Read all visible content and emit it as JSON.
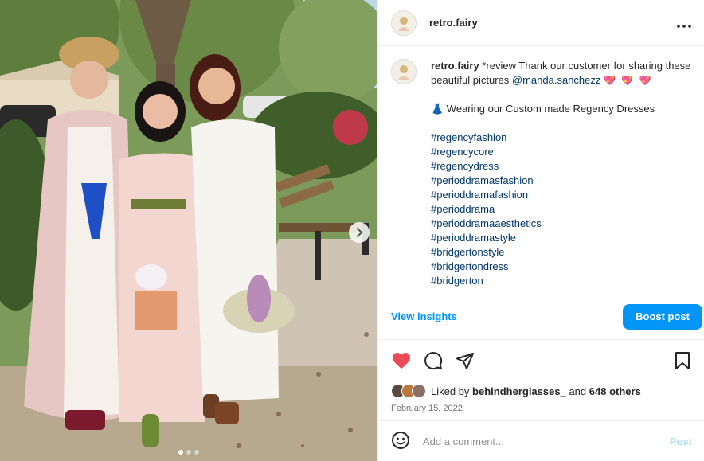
{
  "account": {
    "username": "retro.fairy"
  },
  "caption": {
    "username": "retro.fairy",
    "text": "*review Thank our customer for sharing these beautiful pictures",
    "mention": "@manda.sanchezz",
    "hearts": "💖 💖 💖",
    "dress_line": "👗 Wearing our Custom made Regency Dresses",
    "hashtags": [
      "#regencyfashion",
      "#regencycore",
      "#regencydress",
      "#perioddramasfashion",
      "#perioddramafashion",
      "#perioddrama",
      "#perioddramaaesthetics",
      "#perioddramastyle",
      "#bridgertonstyle",
      "#bridgertondress",
      "#bridgerton"
    ]
  },
  "insights": {
    "view_label": "View insights",
    "boost_label": "Boost post"
  },
  "likes": {
    "prefix": "Liked by",
    "user": "behindherglasses_",
    "connector": "and",
    "others": "648 others"
  },
  "date": "February 15, 2022",
  "comment": {
    "placeholder": "Add a comment...",
    "post_label": "Post"
  },
  "carousel": {
    "slide_count": 3,
    "active_index": 0
  },
  "icons": {
    "more": "more-horizontal-icon",
    "like": "heart-icon",
    "comment": "comment-icon",
    "share": "share-icon",
    "save": "bookmark-icon",
    "emoji": "emoji-icon",
    "next": "chevron-right-icon"
  },
  "colors": {
    "accent": "#0095f6",
    "like": "#ed4956",
    "link": "#00376b",
    "muted": "#737373"
  }
}
